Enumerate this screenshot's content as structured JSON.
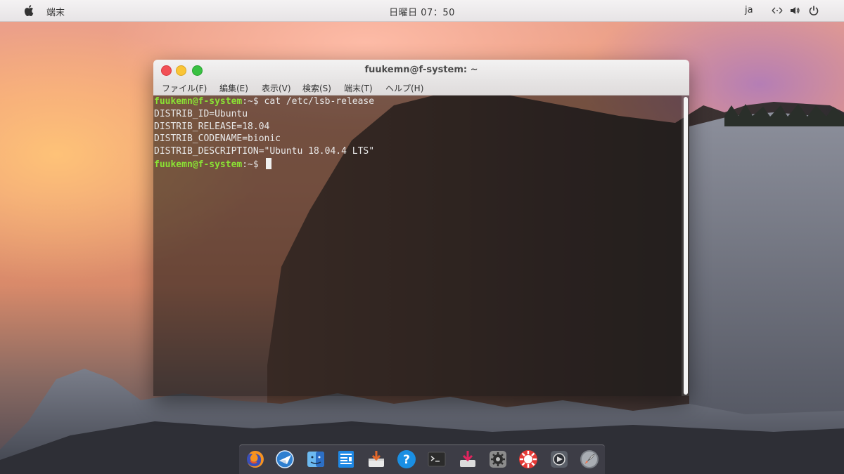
{
  "topbar": {
    "app_name": "端末",
    "clock": "日曜日 07：50",
    "input_lang": "ja",
    "icons": [
      "apple-logo-icon",
      "network-icon",
      "volume-icon",
      "power-icon"
    ]
  },
  "window": {
    "title": "fuukemn@f-system: ~",
    "menu": [
      "ファイル(F)",
      "編集(E)",
      "表示(V)",
      "検索(S)",
      "端末(T)",
      "ヘルプ(H)"
    ]
  },
  "terminal": {
    "prompt_user": "fuukemn@f-system",
    "prompt_path": ":~$",
    "command": "cat /etc/lsb-release",
    "output": [
      "DISTRIB_ID=Ubuntu",
      "DISTRIB_RELEASE=18.04",
      "DISTRIB_CODENAME=bionic",
      "DISTRIB_DESCRIPTION=\"Ubuntu 18.04.4 LTS\""
    ]
  },
  "dock": {
    "apps": [
      "firefox-icon",
      "browser-globe-icon",
      "finder-icon",
      "text-editor-icon",
      "installer-icon",
      "help-icon",
      "terminal-icon",
      "downloads-icon",
      "system-settings-icon",
      "software-center-icon",
      "media-player-icon",
      "launchpad-rocket-icon"
    ]
  },
  "colors": {
    "prompt_green": "#8ae234",
    "close": "#f25056",
    "minimize": "#fac536",
    "maximize": "#39c142"
  }
}
